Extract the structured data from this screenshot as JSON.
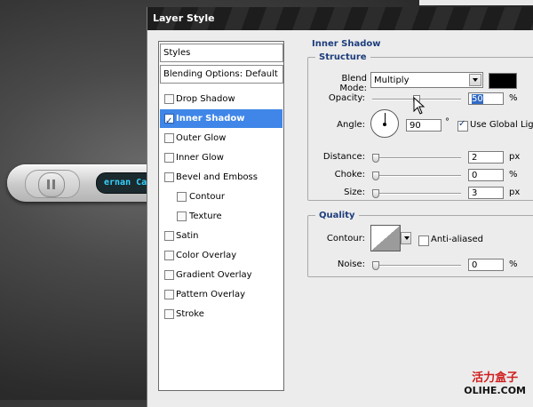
{
  "background": {
    "display_text": "ernan Catt"
  },
  "dialog": {
    "title": "Layer Style",
    "sidebar": {
      "header": "Styles",
      "blending": "Blending Options: Default",
      "items": [
        {
          "label": "Drop Shadow",
          "checked": false,
          "sub": false
        },
        {
          "label": "Inner Shadow",
          "checked": true,
          "sub": false,
          "active": true
        },
        {
          "label": "Outer Glow",
          "checked": false,
          "sub": false
        },
        {
          "label": "Inner Glow",
          "checked": false,
          "sub": false
        },
        {
          "label": "Bevel and Emboss",
          "checked": false,
          "sub": false
        },
        {
          "label": "Contour",
          "checked": false,
          "sub": true
        },
        {
          "label": "Texture",
          "checked": false,
          "sub": true
        },
        {
          "label": "Satin",
          "checked": false,
          "sub": false
        },
        {
          "label": "Color Overlay",
          "checked": false,
          "sub": false
        },
        {
          "label": "Gradient Overlay",
          "checked": false,
          "sub": false
        },
        {
          "label": "Pattern Overlay",
          "checked": false,
          "sub": false
        },
        {
          "label": "Stroke",
          "checked": false,
          "sub": false
        }
      ]
    },
    "panel_title": "Inner Shadow",
    "structure": {
      "legend": "Structure",
      "blend_mode_label": "Blend Mode:",
      "blend_mode_value": "Multiply",
      "color": "#000000",
      "opacity_label": "Opacity:",
      "opacity_value": "50",
      "opacity_unit": "%",
      "angle_label": "Angle:",
      "angle_value": "90",
      "angle_unit": "°",
      "use_global_light": "Use Global Light",
      "use_global_light_checked": true,
      "distance_label": "Distance:",
      "distance_value": "2",
      "distance_unit": "px",
      "choke_label": "Choke:",
      "choke_value": "0",
      "choke_unit": "%",
      "size_label": "Size:",
      "size_value": "3",
      "size_unit": "px"
    },
    "quality": {
      "legend": "Quality",
      "contour_label": "Contour:",
      "anti_aliased": "Anti-aliased",
      "anti_aliased_checked": false,
      "noise_label": "Noise:",
      "noise_value": "0",
      "noise_unit": "%"
    }
  },
  "watermark": {
    "cn": "活力盒子",
    "en": "OLIHE.COM"
  },
  "icons": [
    "pause-icon",
    "mouse-cursor-icon",
    "dropdown-arrow-icon",
    "checkmark-icon",
    "angle-dial-icon",
    "contour-preview-icon"
  ]
}
